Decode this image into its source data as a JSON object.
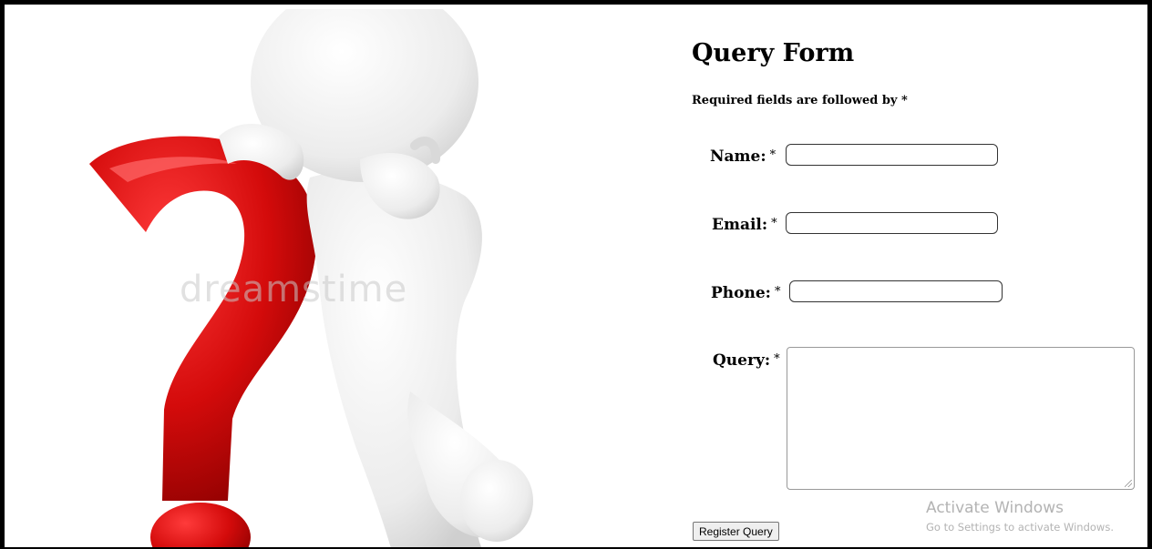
{
  "image": {
    "description_icon": "question-mark-figure-illustration",
    "watermark": "dreamstime"
  },
  "form": {
    "title": "Query Form",
    "required_note": "Required fields are followed by *",
    "fields": {
      "name": {
        "label": "Name:",
        "required_mark": "*",
        "value": ""
      },
      "email": {
        "label": "Email:",
        "required_mark": "*",
        "value": ""
      },
      "phone": {
        "label": "Phone:",
        "required_mark": "*",
        "value": ""
      },
      "query": {
        "label": "Query:",
        "required_mark": "*",
        "value": ""
      }
    },
    "submit_label": "Register Query"
  },
  "os_overlay": {
    "title": "Activate Windows",
    "subtitle": "Go to Settings to activate Windows."
  },
  "colors": {
    "question_mark": "#d80d0d",
    "figure": "#ebebeb",
    "border": "#000000"
  }
}
